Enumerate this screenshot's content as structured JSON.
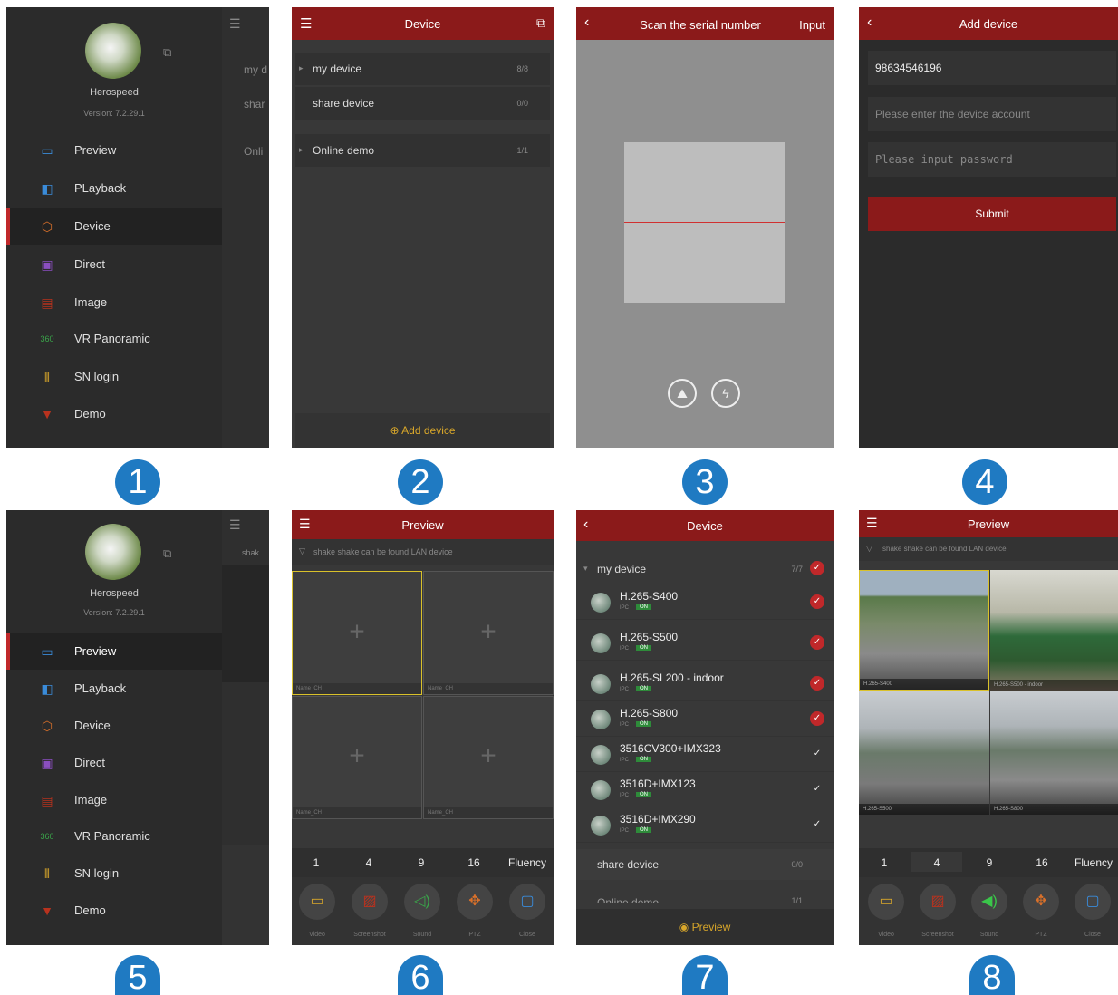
{
  "badges": [
    "1",
    "2",
    "3",
    "4",
    "5",
    "6",
    "7",
    "8"
  ],
  "drawer": {
    "app_name": "Herospeed",
    "version": "Version: 7.2.29.1",
    "items": [
      {
        "label": "Preview",
        "icon": "▭",
        "color": "#3a8bd9"
      },
      {
        "label": "PLayback",
        "icon": "◧",
        "color": "#3a8bd9"
      },
      {
        "label": "Device",
        "icon": "⬡",
        "color": "#d9702a"
      },
      {
        "label": "Direct",
        "icon": "▣",
        "color": "#8a4ec0"
      },
      {
        "label": "Image",
        "icon": "▤",
        "color": "#b8321e"
      },
      {
        "label": "VR Panoramic",
        "icon": "360",
        "color": "#3aa64a"
      },
      {
        "label": "SN login",
        "icon": "⦀",
        "color": "#d9a72a"
      },
      {
        "label": "Demo",
        "icon": "▼",
        "color": "#b8321e"
      }
    ],
    "bg_peek": [
      "my d",
      "shar",
      "Onli"
    ],
    "bg_peek5": [
      "shak"
    ]
  },
  "device_list": {
    "title": "Device",
    "groups": [
      {
        "label": "my device",
        "count": "8/8"
      },
      {
        "label": "share device",
        "count": "0/0"
      },
      {
        "label": "Online demo",
        "count": "1/1"
      }
    ],
    "add_label": "Add device"
  },
  "scan": {
    "title": "Scan the serial number",
    "input_label": "Input"
  },
  "add_device": {
    "title": "Add device",
    "serial_value": "98634546196",
    "account_placeholder": "Please enter the device account",
    "password_placeholder": "Please input password",
    "submit_label": "Submit"
  },
  "preview": {
    "title": "Preview",
    "hint": "shake shake can be found LAN device",
    "cell_label": "Name_CH",
    "split_options": [
      "1",
      "4",
      "9",
      "16",
      "Fluency"
    ],
    "controls": [
      "Video",
      "Screenshot",
      "Sound",
      "PTZ",
      "Close"
    ],
    "live_labels": [
      "H.265-S400",
      "H.265-S500 - indoor",
      "H.265-S500",
      "H.265-S800"
    ]
  },
  "device_select": {
    "title": "Device",
    "group_label": "my device",
    "group_count": "7/7",
    "devices": [
      {
        "name": "H.265-S400",
        "type": "IPC",
        "status": "ON",
        "checked": "red"
      },
      {
        "name": "H.265-S500",
        "type": "IPC",
        "status": "ON",
        "checked": "red"
      },
      {
        "name": "H.265-SL200 - indoor",
        "type": "IPC",
        "status": "ON",
        "checked": "red"
      },
      {
        "name": "H.265-S800",
        "type": "IPC",
        "status": "ON",
        "checked": "red"
      },
      {
        "name": "3516CV300+IMX323",
        "type": "IPC",
        "status": "ON",
        "checked": "plain"
      },
      {
        "name": "3516D+IMX123",
        "type": "IPC",
        "status": "ON",
        "checked": "plain"
      },
      {
        "name": "3516D+IMX290",
        "type": "IPC",
        "status": "ON",
        "checked": "plain"
      }
    ],
    "share_label": "share device",
    "share_count": "0/0",
    "online_label": "Online demo",
    "online_count": "1/1",
    "preview_label": "Preview"
  },
  "colors": {
    "header": "#8b1a1a",
    "accent": "#d9a72a",
    "badge": "#1f7ac2",
    "active": "#c0282a"
  }
}
